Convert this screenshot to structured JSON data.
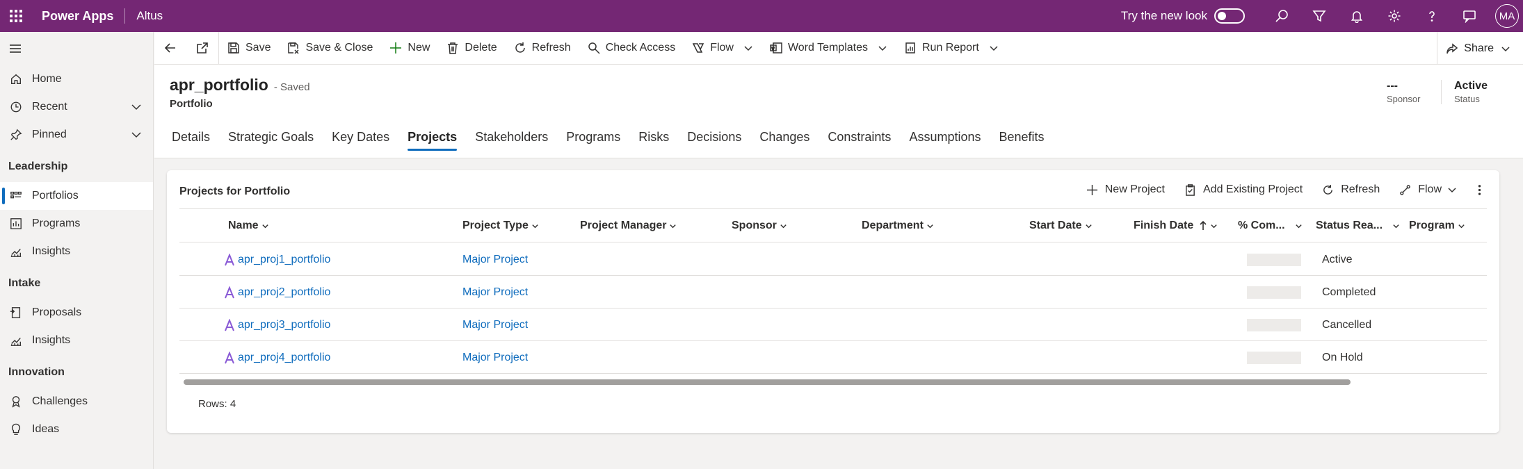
{
  "topbar": {
    "app_name": "Power Apps",
    "environment": "Altus",
    "try_new_look": "Try the new look",
    "avatar_initials": "MA"
  },
  "sidebar": {
    "items_top": [
      {
        "label": "Home",
        "icon": "home-icon"
      },
      {
        "label": "Recent",
        "icon": "clock-icon"
      },
      {
        "label": "Pinned",
        "icon": "pin-icon"
      }
    ],
    "groups": [
      {
        "title": "Leadership",
        "items": [
          {
            "label": "Portfolios",
            "icon": "portfolio-icon",
            "active": true
          },
          {
            "label": "Programs",
            "icon": "programs-icon"
          },
          {
            "label": "Insights",
            "icon": "insights-icon"
          }
        ]
      },
      {
        "title": "Intake",
        "items": [
          {
            "label": "Proposals",
            "icon": "proposals-icon"
          },
          {
            "label": "Insights",
            "icon": "insights-icon"
          }
        ]
      },
      {
        "title": "Innovation",
        "items": [
          {
            "label": "Challenges",
            "icon": "challenges-icon"
          },
          {
            "label": "Ideas",
            "icon": "ideas-icon"
          }
        ]
      }
    ]
  },
  "commandbar": {
    "save": "Save",
    "save_close": "Save & Close",
    "new": "New",
    "delete": "Delete",
    "refresh": "Refresh",
    "check_access": "Check Access",
    "flow": "Flow",
    "word_templates": "Word Templates",
    "run_report": "Run Report",
    "share": "Share"
  },
  "record": {
    "title": "apr_portfolio",
    "save_state": "- Saved",
    "entity": "Portfolio",
    "sponsor_value": "---",
    "sponsor_label": "Sponsor",
    "status_value": "Active",
    "status_label": "Status"
  },
  "tabs": [
    "Details",
    "Strategic Goals",
    "Key Dates",
    "Projects",
    "Stakeholders",
    "Programs",
    "Risks",
    "Decisions",
    "Changes",
    "Constraints",
    "Assumptions",
    "Benefits"
  ],
  "active_tab": "Projects",
  "subgrid": {
    "title": "Projects for Portfolio",
    "new_project": "New Project",
    "add_existing": "Add Existing Project",
    "refresh": "Refresh",
    "flow": "Flow",
    "columns": [
      "Name",
      "Project Type",
      "Project Manager",
      "Sponsor",
      "Department",
      "Start Date",
      "Finish Date",
      "% Com...",
      "Status Rea...",
      "Program"
    ],
    "rows": [
      {
        "name": "apr_proj1_portfolio",
        "type": "Major Project",
        "status_reason": "Active"
      },
      {
        "name": "apr_proj2_portfolio",
        "type": "Major Project",
        "status_reason": "Completed"
      },
      {
        "name": "apr_proj3_portfolio",
        "type": "Major Project",
        "status_reason": "Cancelled"
      },
      {
        "name": "apr_proj4_portfolio",
        "type": "Major Project",
        "status_reason": "On Hold"
      }
    ],
    "rows_label": "Rows: 4"
  },
  "colors": {
    "topbar": "#742774",
    "accent": "#0f6cbd",
    "new_plus": "#107c10",
    "project_icon": "#8a5bd6"
  }
}
